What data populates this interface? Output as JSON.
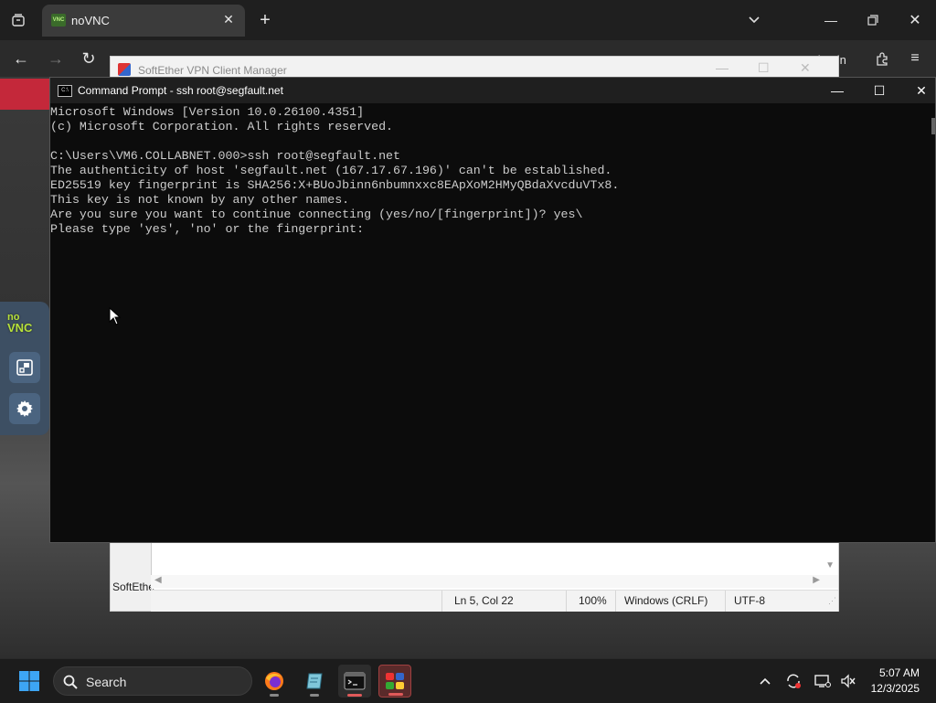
{
  "browser": {
    "tab": {
      "title": "noVNC"
    },
    "user_button": "Sign in"
  },
  "softether": {
    "title": "SoftEther VPN Client Manager",
    "taskbar_label": "SoftEthe"
  },
  "notepad": {
    "status": {
      "position": "Ln 5, Col 22",
      "zoom": "100%",
      "line_ending": "Windows (CRLF)",
      "encoding": "UTF-8"
    }
  },
  "novnc": {
    "logo_line1": "no",
    "logo_line2": "VNC"
  },
  "cmd": {
    "title": "Command Prompt - ssh  root@segfault.net",
    "icon_text": "C:\\",
    "lines": [
      "Microsoft Windows [Version 10.0.26100.4351]",
      "(c) Microsoft Corporation. All rights reserved.",
      "",
      "C:\\Users\\VM6.COLLABNET.000>ssh root@segfault.net",
      "The authenticity of host 'segfault.net (167.17.67.196)' can't be established.",
      "ED25519 key fingerprint is SHA256:X+BUoJbinn6nbumnxxc8EApXoM2HMyQBdaXvcduVTx8.",
      "This key is not known by any other names.",
      "Are you sure you want to continue connecting (yes/no/[fingerprint])? yes\\",
      "Please type 'yes', 'no' or the fingerprint:"
    ]
  },
  "taskbar": {
    "search_label": "Search",
    "time": "5:07 AM",
    "date": "12/3/2025"
  },
  "colors": {
    "accent_red": "#c4283a",
    "terminal_text": "#cccccc",
    "novnc_panel": "#3d4f63"
  }
}
